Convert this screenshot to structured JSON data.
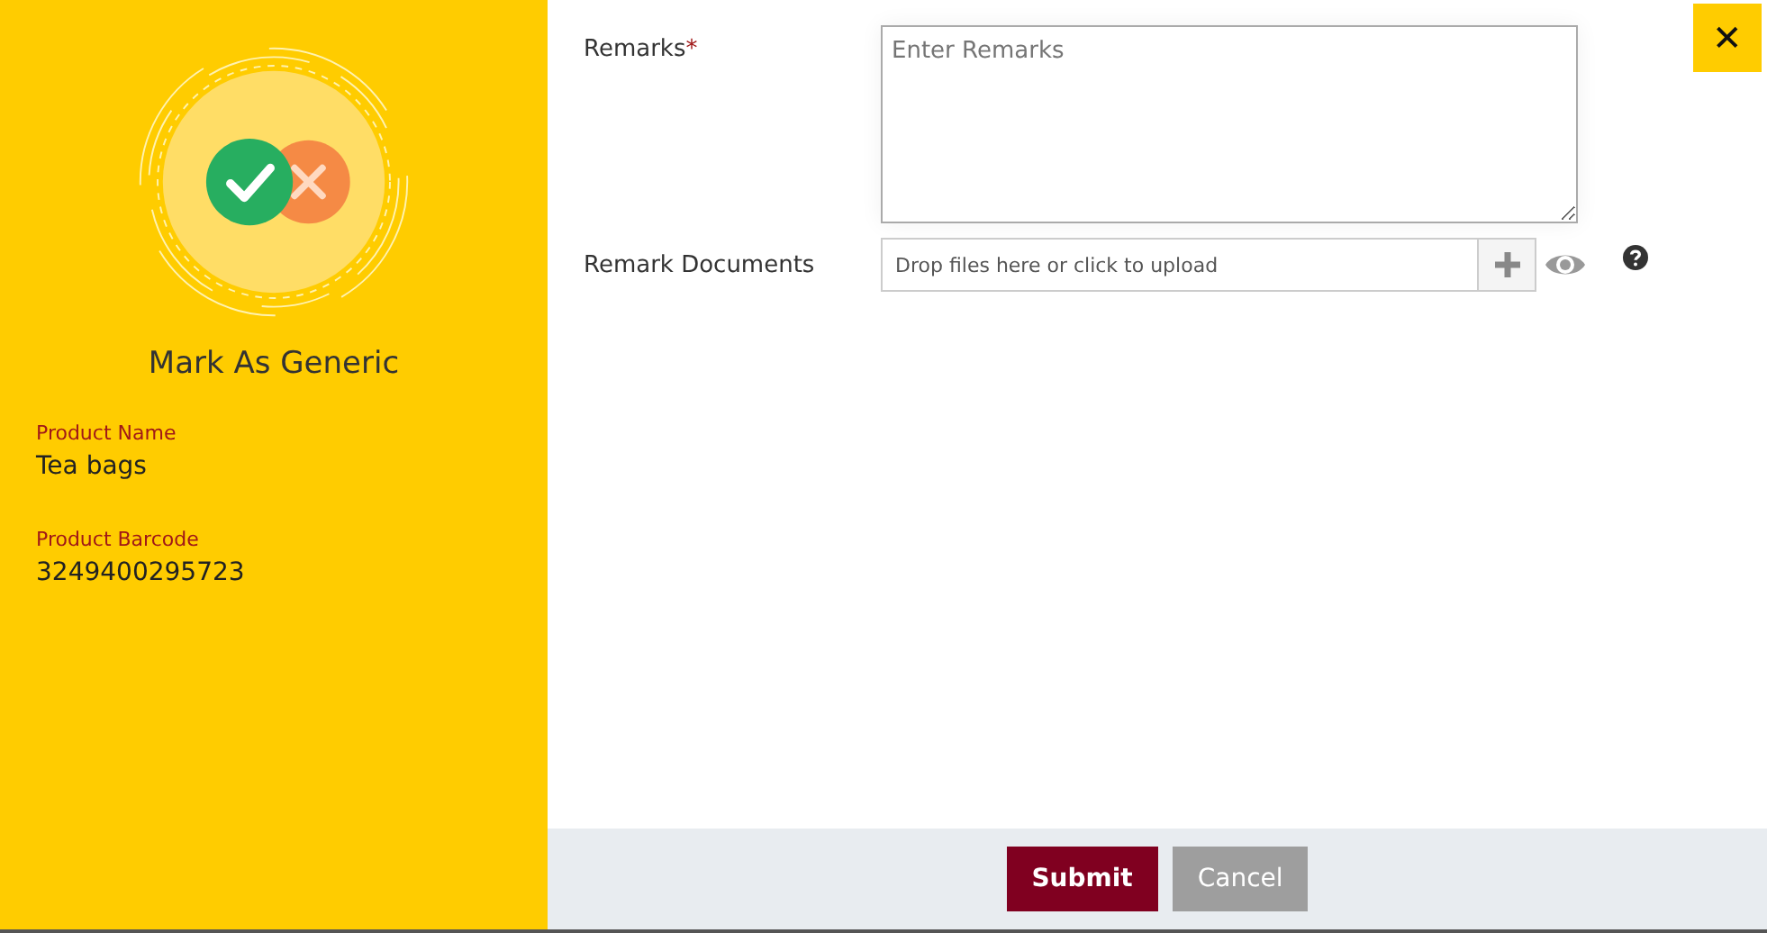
{
  "sidebar": {
    "title": "Mark As Generic",
    "details": [
      {
        "label": "Product Name",
        "value": "Tea bags"
      },
      {
        "label": "Product Barcode",
        "value": "3249400295723"
      }
    ]
  },
  "form": {
    "remarks": {
      "label": "Remarks",
      "required_mark": "*",
      "placeholder": "Enter Remarks"
    },
    "documents": {
      "label": "Remark Documents",
      "placeholder": "Drop files here or click to upload"
    }
  },
  "close_button": {
    "label": "✕"
  },
  "buttons": [
    {
      "label": "Submit",
      "kind": "primary"
    },
    {
      "label": "Cancel",
      "kind": "secondary"
    }
  ]
}
